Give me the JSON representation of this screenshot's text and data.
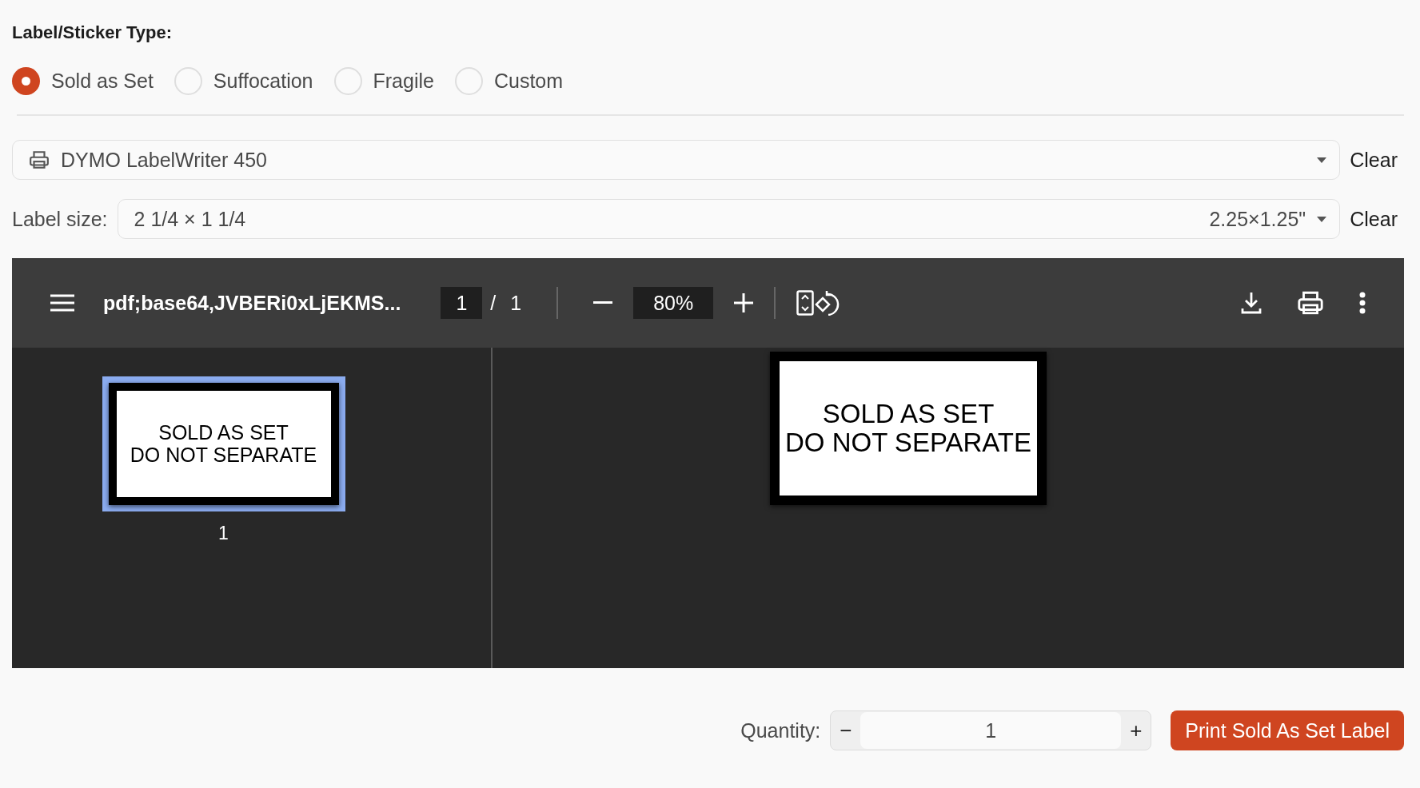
{
  "label_type": {
    "title": "Label/Sticker Type:",
    "options": [
      {
        "label": "Sold as Set",
        "selected": true
      },
      {
        "label": "Suffocation",
        "selected": false
      },
      {
        "label": "Fragile",
        "selected": false
      },
      {
        "label": "Custom",
        "selected": false
      }
    ]
  },
  "printer": {
    "value": "DYMO LabelWriter 450",
    "clear": "Clear"
  },
  "label_size": {
    "label": "Label size:",
    "value": "2 1/4 × 1 1/4",
    "hint": "2.25×1.25\"",
    "clear": "Clear"
  },
  "viewer": {
    "title": "pdf;base64,JVBERi0xLjEKMS...",
    "page": "1",
    "separator": "/",
    "pages": "1",
    "zoom": "80%",
    "thumbnail": {
      "lines": [
        "SOLD AS SET",
        "DO NOT SEPARATE"
      ],
      "number": "1",
      "selected": true
    },
    "page_lines": [
      "SOLD AS SET",
      "DO NOT SEPARATE"
    ]
  },
  "quantity": {
    "label": "Quantity:",
    "minus": "−",
    "value": "1",
    "plus": "+"
  },
  "print_button": "Print Sold As Set Label"
}
